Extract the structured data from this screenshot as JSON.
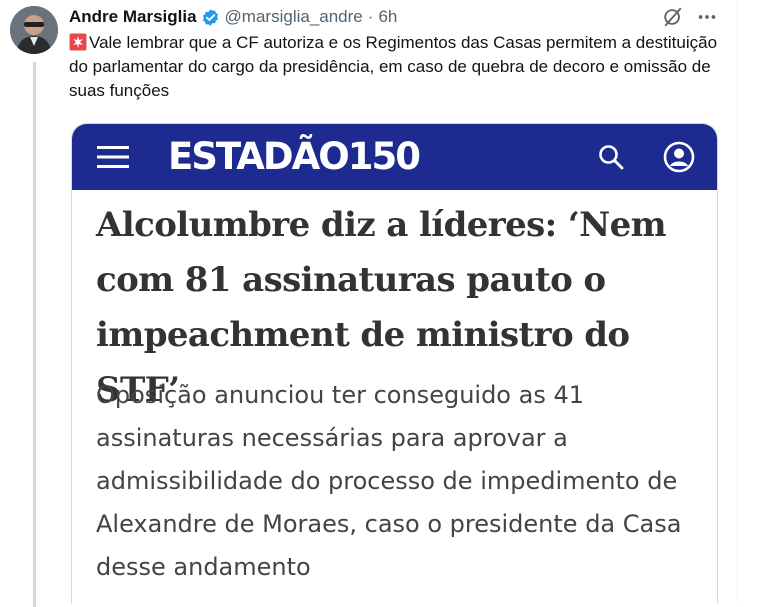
{
  "tweet": {
    "author_name": "Andre Marsiglia",
    "handle": "@marsiglia_andre",
    "separator": "·",
    "time": "6h",
    "text": "Vale lembrar que a CF autoriza e os Regimentos das Casas permitem a destituição do parlamentar do cargo da presidência, em caso de quebra de decoro e omissão de suas funções",
    "icons": {
      "verified": "verified-badge-icon",
      "grok": "grok-icon",
      "more": "more-horizontal-icon",
      "emoji": "police-siren-emoji"
    }
  },
  "card": {
    "brand": "ESTADÃO150",
    "headline": "Alcolumbre diz a líderes: ‘Nem com 81 assinaturas pauto o impeachment de ministro do STF’",
    "subheadline": "Oposição anunciou ter conseguido as 41 assinaturas necessárias para aprovar a admissibilidade do processo de impedimento de Alexandre de Moraes, caso o presidente da Casa desse andamento",
    "icons": {
      "menu": "hamburger-menu-icon",
      "search": "search-icon",
      "account": "user-account-icon"
    }
  },
  "colors": {
    "verified_blue": "#1d9bf0",
    "navbar_blue": "#1d2a8f",
    "secondary_text": "#536471",
    "thread_line": "#cfd9de"
  }
}
